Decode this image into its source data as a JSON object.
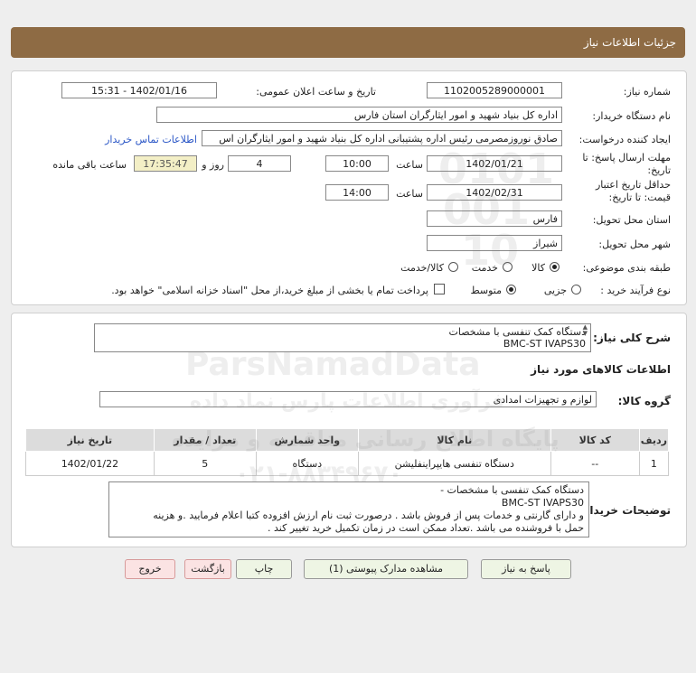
{
  "header": {
    "title": "جزئیات اطلاعات نیاز"
  },
  "form": {
    "need_number_label": "شماره نیاز:",
    "need_number": "1102005289000001",
    "announce_label": "تاریخ و ساعت اعلان عمومی:",
    "announce_value": "1402/01/16 - 15:31",
    "buyer_label": "نام دستگاه خریدار:",
    "buyer_value": "اداره کل بنیاد شهید و امور ایثارگران استان فارس",
    "creator_label": "ایجاد کننده درخواست:",
    "creator_value": "صادق نوروزمصرمی رئیس اداره پشتیبانی اداره کل بنیاد شهید و امور ایثارگران اس",
    "contact_link": "اطلاعات تماس خریدار",
    "deadline_label_1": "مهلت ارسال پاسخ: تا",
    "deadline_label_2": "تاریخ:",
    "deadline_date": "1402/01/21",
    "time_label": "ساعت",
    "deadline_time": "10:00",
    "days_value": "4",
    "days_label": "روز و",
    "remaining_time": "17:35:47",
    "remaining_label": "ساعت باقی مانده",
    "validity_label_1": "حداقل تاریخ اعتبار",
    "validity_label_2": "قیمت: تا تاریخ:",
    "validity_date": "1402/02/31",
    "validity_time": "14:00",
    "province_label": "استان محل تحویل:",
    "province_value": "فارس",
    "city_label": "شهر محل تحویل:",
    "city_value": "شیراز",
    "category_label": "طبقه بندی موضوعی:",
    "category_options": [
      "کالا",
      "خدمت",
      "کالا/خدمت"
    ],
    "process_label": "نوع فرآیند خرید :",
    "process_options": [
      "جزیی",
      "متوسط"
    ],
    "treasury_text": "پرداخت تمام یا بخشی از مبلغ خرید،از محل \"اسناد خزانه اسلامی\" خواهد بود."
  },
  "summary": {
    "label": "شرح کلی نیاز:",
    "line1": "دستگاه کمک تنفسی با مشخصات",
    "line2": "BMC-ST IVAPS30"
  },
  "goods": {
    "section_title": "اطلاعات کالاهای مورد نیاز",
    "group_label": "گروه کالا:",
    "group_value": "لوازم و تجهیزات امدادی",
    "columns": [
      "ردیف",
      "کد کالا",
      "نام کالا",
      "واحد شمارش",
      "تعداد / مقدار",
      "تاریخ نیاز"
    ],
    "rows": [
      [
        "1",
        "--",
        "دستگاه تنفسی هایپراینفلیشن",
        "دستگاه",
        "5",
        "1402/01/22"
      ]
    ]
  },
  "buyer_notes": {
    "label": "توضیحات خریدار:",
    "line1": "دستگاه کمک تنفسی با مشخصات -",
    "line2": "BMC-ST IVAPS30",
    "line3": "و دارای گارنتی و خدمات پس از فروش باشد . درصورت ثبت نام ارزش افزوده کتبا اعلام فرمایید .و هزینه",
    "line4": "حمل با فروشنده می باشد .تعداد ممکن است در زمان تکمیل خرید تغییر کند ."
  },
  "buttons": {
    "reply": "پاسخ به نیاز",
    "attachments": "مشاهده مدارک پیوستی (1)",
    "print": "چاپ",
    "back": "بازگشت",
    "exit": "خروج"
  },
  "watermark": {
    "brand": "ParsNamadData",
    "line_fa_1": "پایگاه اطلاع رسانی مناقصه و مزایده",
    "line_fa_2": "فرآوری اطلاعات پارس نماد داده",
    "phone": "۰۲۱-۸۸۳۴۹۶۷۰",
    "digits_1": "0101",
    "digits_2": "001",
    "digits_3": "10"
  },
  "colors": {
    "header_bg": "#8e6b44",
    "link": "#2a56c6",
    "highlight": "#f3efc6"
  }
}
